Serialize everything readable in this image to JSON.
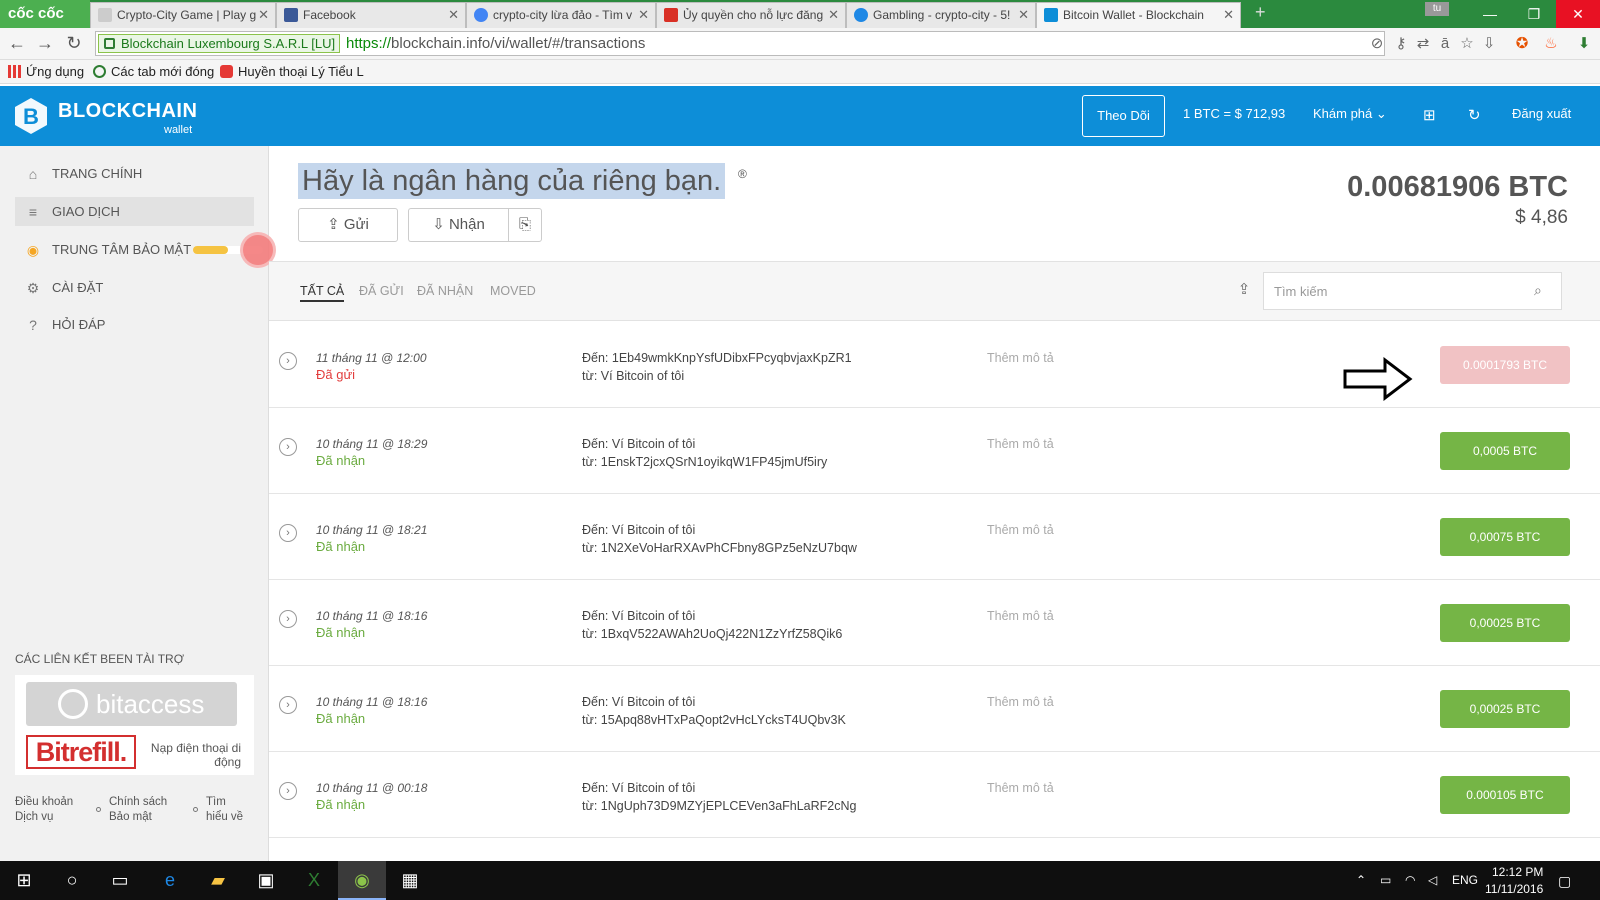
{
  "browser": {
    "brand": "cốc cốc",
    "tabs": [
      {
        "title": "Crypto-City Game | Play g",
        "favicon_color": "#cccccc"
      },
      {
        "title": "Facebook",
        "favicon_color": "#3b5998"
      },
      {
        "title": "crypto-city lừa đảo - Tìm v",
        "favicon_color": "#4285f4"
      },
      {
        "title": "Ủy quyền cho nỗ lực đăng",
        "favicon_color": "#d93025"
      },
      {
        "title": "Gambling - crypto-city - 5!",
        "favicon_color": "#1e88e5"
      },
      {
        "title": "Bitcoin Wallet - Blockchain",
        "favicon_color": "#0d8ed8"
      }
    ],
    "active_tab_index": 5,
    "user_badge": "tu",
    "ssl_label": "Blockchain Luxembourg S.A.R.L [LU]",
    "url_scheme": "https://",
    "url_rest": "blockchain.info/vi/wallet/#/transactions",
    "bookmarks": [
      "Ứng dụng",
      "Các tab mới đóng",
      "Huyền thoại Lý Tiểu L"
    ]
  },
  "header": {
    "logo_text": "BLOCKCHAIN",
    "logo_sub": "wallet",
    "follow_label": "Theo Dõi",
    "rate_label": "1 BTC = $ 712,93",
    "explore_label": "Khám phá",
    "logout_label": "Đăng xuất",
    "brand_color": "#0d8ed8"
  },
  "sidebar": {
    "items": [
      {
        "label": "TRANG CHÍNH",
        "icon": "home-icon",
        "active": false
      },
      {
        "label": "GIAO DỊCH",
        "icon": "list-icon",
        "active": true
      },
      {
        "label": "TRUNG TÂM BẢO MẬT",
        "icon": "lock-icon",
        "active": false
      },
      {
        "label": "CÀI ĐẶT",
        "icon": "gear-icon",
        "active": false
      },
      {
        "label": "HỎI ĐÁP",
        "icon": "question-icon",
        "active": false
      }
    ],
    "security_progress": 0.5,
    "sponsor_title": "CÁC LIÊN KẾT BEEN TÀI TRỢ",
    "bitaccess_label": "bitaccess",
    "bitrefill_label": "Bitrefill.",
    "bitrefill_caption": "Nạp điện thoại di động",
    "footer_links": [
      "Điều khoản Dịch vụ",
      "Chính sách Bảo mật",
      "Tìm hiểu về"
    ]
  },
  "main": {
    "hero": "Hãy là ngân hàng của riêng bạn.",
    "hero_mark": "®",
    "send_label": "Gửi",
    "receive_label": "Nhận",
    "balance_btc": "0.00681906 BTC",
    "balance_usd": "$ 4,86",
    "filters": [
      "TẤT CẢ",
      "ĐÃ GỬI",
      "ĐÃ NHẬN",
      "MOVED"
    ],
    "active_filter": 0,
    "search_placeholder": "Tìm kiếm"
  },
  "transactions": [
    {
      "date": "11 tháng 11 @ 12:00",
      "direction": "Đã gửi",
      "type": "sent",
      "to": "Đến: 1Eb49wmkKnpYsfUDibxFPcyqbvjaxKpZR1",
      "from": "từ: Ví Bitcoin of tôi",
      "desc": "Thêm mô tả",
      "amount": "0.0001793 BTC"
    },
    {
      "date": "10 tháng 11 @ 18:29",
      "direction": "Đã nhận",
      "type": "recv",
      "to": "Đến: Ví Bitcoin of tôi",
      "from": "từ: 1EnskT2jcxQSrN1oyikqW1FP45jmUf5iry",
      "desc": "Thêm mô tả",
      "amount": "0,0005 BTC"
    },
    {
      "date": "10 tháng 11 @ 18:21",
      "direction": "Đã nhận",
      "type": "recv",
      "to": "Đến: Ví Bitcoin of tôi",
      "from": "từ: 1N2XeVoHarRXAvPhCFbny8GPz5eNzU7bqw",
      "desc": "Thêm mô tả",
      "amount": "0,00075 BTC"
    },
    {
      "date": "10 tháng 11 @ 18:16",
      "direction": "Đã nhận",
      "type": "recv",
      "to": "Đến: Ví Bitcoin of tôi",
      "from": "từ: 1BxqV522AWAh2UoQj422N1ZzYrfZ58Qik6",
      "desc": "Thêm mô tả",
      "amount": "0,00025 BTC"
    },
    {
      "date": "10 tháng 11 @ 18:16",
      "direction": "Đã nhận",
      "type": "recv",
      "to": "Đến: Ví Bitcoin of tôi",
      "from": "từ: 15Apq88vHTxPaQopt2vHcLYcksT4UQbv3K",
      "desc": "Thêm mô tả",
      "amount": "0,00025 BTC"
    },
    {
      "date": "10 tháng 11 @ 00:18",
      "direction": "Đã nhận",
      "type": "recv",
      "to": "Đến: Ví Bitcoin of tôi",
      "from": "từ: 1NgUph73D9MZYjEPLCEVen3aFhLaRF2cNg",
      "desc": "Thêm mô tả",
      "amount": "0.000105 BTC"
    }
  ],
  "taskbar": {
    "lang": "ENG",
    "time": "12:12 PM",
    "date": "11/11/2016"
  }
}
